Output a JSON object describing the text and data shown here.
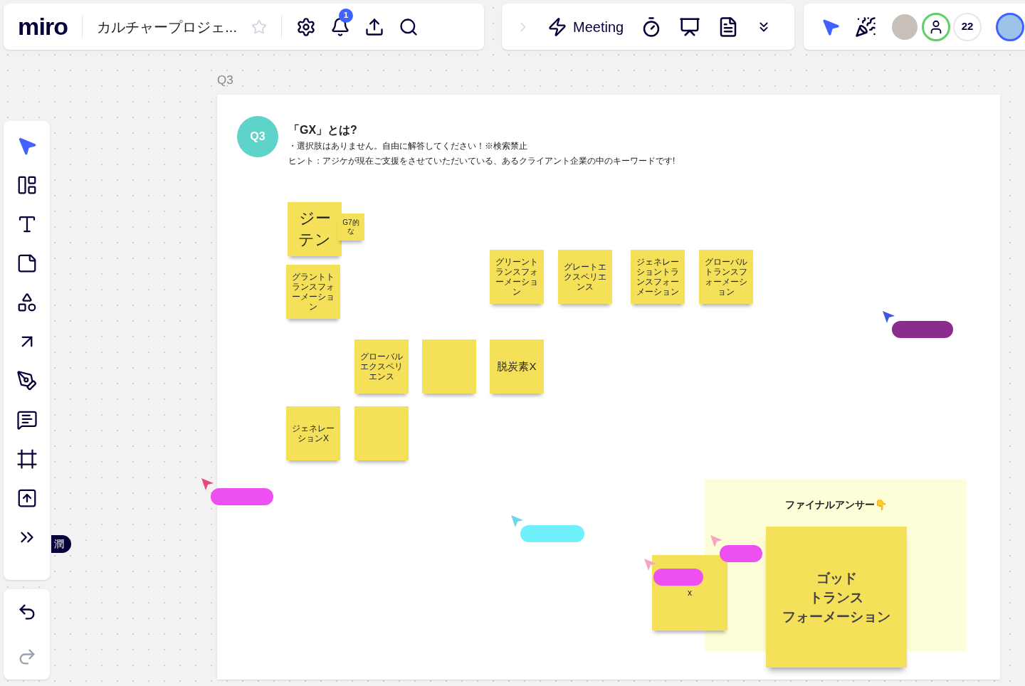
{
  "topbar": {
    "logo": "miro",
    "board_title": "カルチャープロジェ...",
    "starred": false,
    "notification_count": "1",
    "meeting_label": "Meeting",
    "collaborator_count": "22"
  },
  "tools": [
    {
      "selected": true
    },
    {
      "selected": false
    },
    {
      "selected": false
    },
    {
      "selected": false
    },
    {
      "selected": false
    },
    {
      "selected": false
    },
    {
      "selected": false
    },
    {
      "selected": false
    },
    {
      "selected": false
    },
    {
      "selected": false
    },
    {
      "selected": false
    }
  ],
  "history": [
    {
      "disabled": false
    },
    {
      "disabled": true
    }
  ],
  "frame": {
    "label": "Q3",
    "badge": "Q3",
    "title": "「GX」とは?",
    "lines": [
      "・選択肢はありません。自由に解答してください！※検索禁止",
      "ヒント：アジケが現在ご支援をさせていただいている、あるクライアント企業の中のキーワードです!"
    ]
  },
  "stickies": [
    {
      "lines": [
        "ジー",
        "テン"
      ]
    },
    {
      "text": "G7的な"
    },
    {
      "text": "グラントトランスフォーメーション"
    },
    {
      "text": "グリーントランスフォーメーション"
    },
    {
      "text": "グレートエクスペリエンス"
    },
    {
      "text": "ジェネレーショントランスフォーメーション"
    },
    {
      "text": "グローバルトランスフォーメーション"
    },
    {
      "text": "グローバルエクスペリエンス"
    },
    {
      "text": "脱炭素X"
    },
    {
      "text": "ジェネレーションX"
    },
    {
      "text": "x"
    }
  ],
  "final_answer": {
    "title": "ファイナルアンサー👇",
    "answer_lines": [
      "ゴッド",
      "トランス",
      "フォーメーション"
    ]
  },
  "cursors": [
    {
      "color": "#3b5bdb"
    },
    {
      "color": "#e64980"
    },
    {
      "color": "#66d9e8"
    },
    {
      "color": "#f4a6c0"
    },
    {
      "color": "#f4a6c0"
    }
  ],
  "user_tag": {
    "label": "潤"
  }
}
